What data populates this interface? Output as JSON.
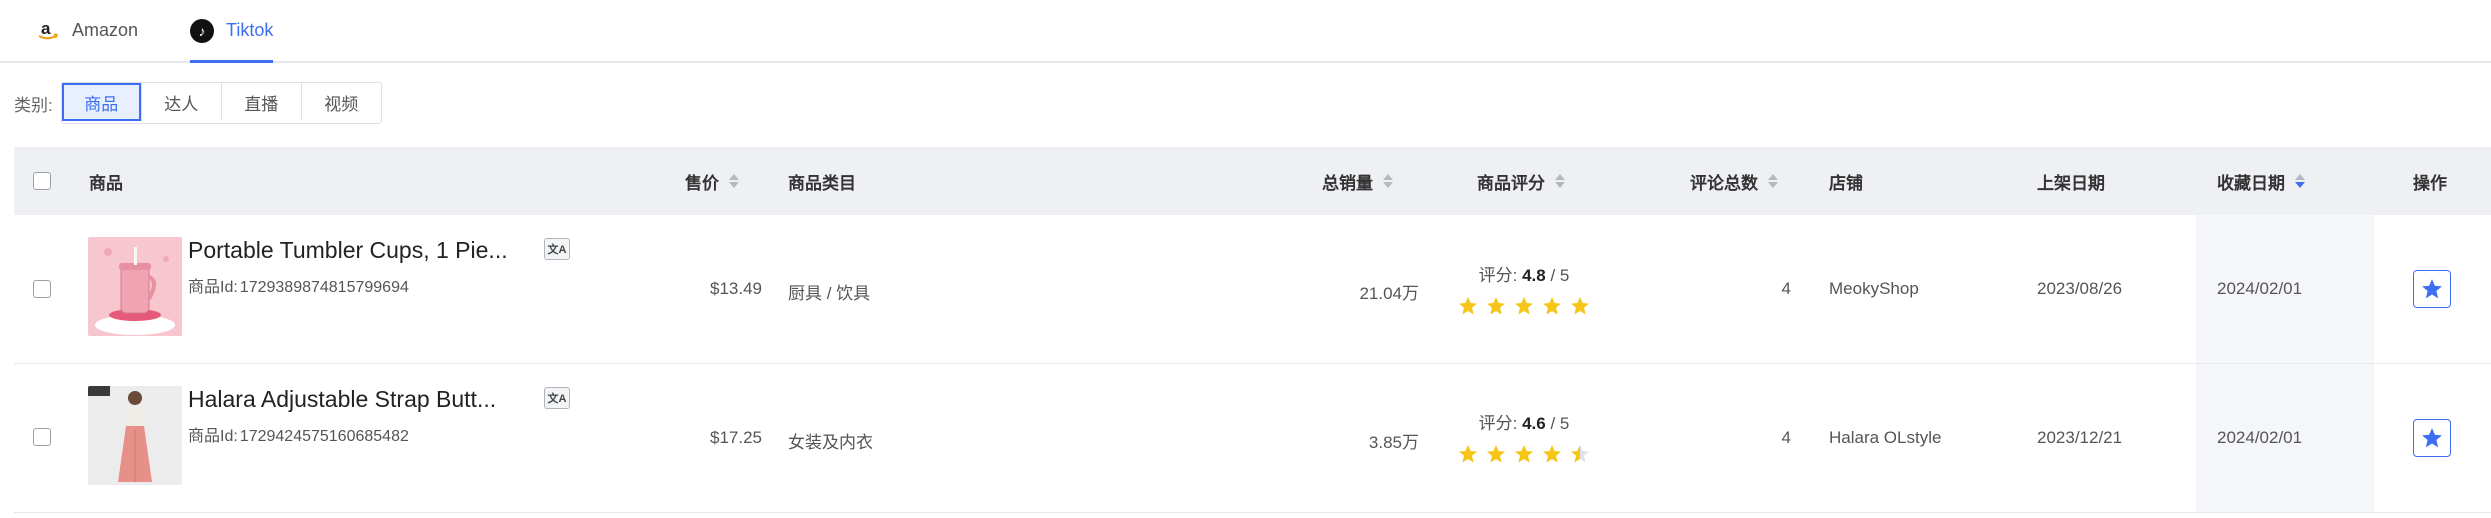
{
  "platform_tabs": [
    {
      "label": "Amazon",
      "icon": "amazon-logo-icon",
      "active": false
    },
    {
      "label": "Tiktok",
      "icon": "tiktok-logo-icon",
      "active": true
    }
  ],
  "category": {
    "label": "类别:",
    "options": [
      "商品",
      "达人",
      "直播",
      "视频"
    ],
    "selected": "商品"
  },
  "table": {
    "columns": {
      "product": "商品",
      "price": "售价",
      "category": "商品类目",
      "total_sales": "总销量",
      "rating": "商品评分",
      "review_count": "评论总数",
      "shop": "店铺",
      "listed_date": "上架日期",
      "favorited_date": "收藏日期",
      "actions": "操作"
    },
    "sorted_column": "favorited_date",
    "sort_direction": "desc",
    "rows": [
      {
        "name": "Portable Tumbler Cups, 1 Pie...",
        "id_label": "商品Id:",
        "id": "1729389874815799694",
        "price": "$13.49",
        "category": "厨具 / 饮具",
        "total_sales": "21.04万",
        "rating_prefix": "评分:",
        "rating": "4.8",
        "rating_max": "/ 5",
        "stars": 5,
        "review_count": "4",
        "shop": "MeokyShop",
        "listed_date": "2023/08/26",
        "favorited_date": "2024/02/01"
      },
      {
        "name": "Halara Adjustable Strap Butt...",
        "id_label": "商品Id:",
        "id": "1729424575160685482",
        "price": "$17.25",
        "category": "女装及内衣",
        "total_sales": "3.85万",
        "rating_prefix": "评分:",
        "rating": "4.6",
        "rating_max": "/ 5",
        "stars": 4.5,
        "review_count": "4",
        "shop": "Halara OLstyle",
        "listed_date": "2023/12/21",
        "favorited_date": "2024/02/01"
      }
    ]
  },
  "colors": {
    "accent": "#3d6df2",
    "star": "#f5c518",
    "header_bg": "#eef0f4"
  }
}
